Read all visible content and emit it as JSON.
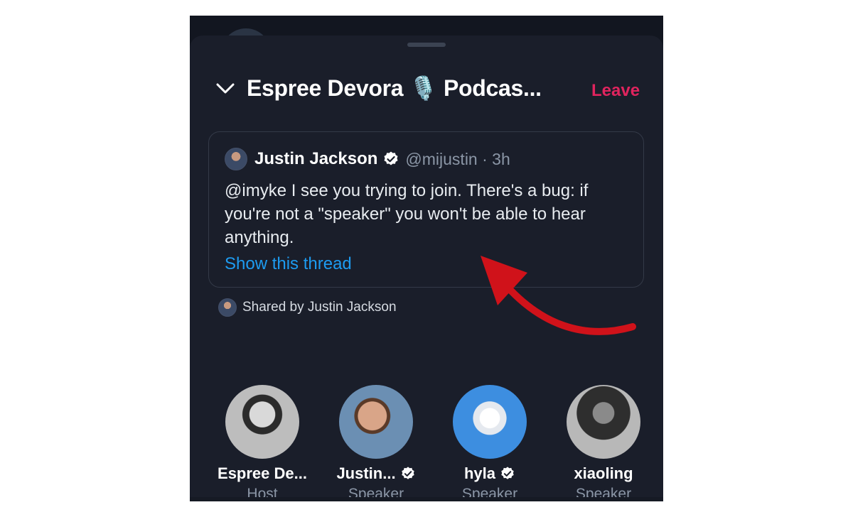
{
  "header": {
    "title": "Espree Devora 🎙️ Podcas...",
    "leave_label": "Leave"
  },
  "tweet": {
    "author": "Justin Jackson",
    "handle_time": "@mijustin · 3h",
    "text": "@imyke I see you trying to join. There's a bug: if you're not a \"speaker\" you won't be able to hear anything.",
    "thread_link": "Show this thread"
  },
  "shared": {
    "text": "Shared by Justin Jackson"
  },
  "participants": [
    {
      "name": "Espree De...",
      "role": "Host",
      "verified": false,
      "avatar_icon": "avatar-espree"
    },
    {
      "name": "Justin...",
      "role": "Speaker",
      "verified": true,
      "avatar_icon": "avatar-justin"
    },
    {
      "name": "hyla",
      "role": "Speaker",
      "verified": true,
      "avatar_icon": "avatar-hyla"
    },
    {
      "name": "xiaoling",
      "role": "Speaker",
      "verified": false,
      "avatar_icon": "avatar-xiaoling"
    }
  ],
  "colors": {
    "sheet_bg": "#1a1e2a",
    "leave": "#e0245e",
    "link": "#1d9bf0",
    "annotation_arrow": "#d0121a"
  }
}
